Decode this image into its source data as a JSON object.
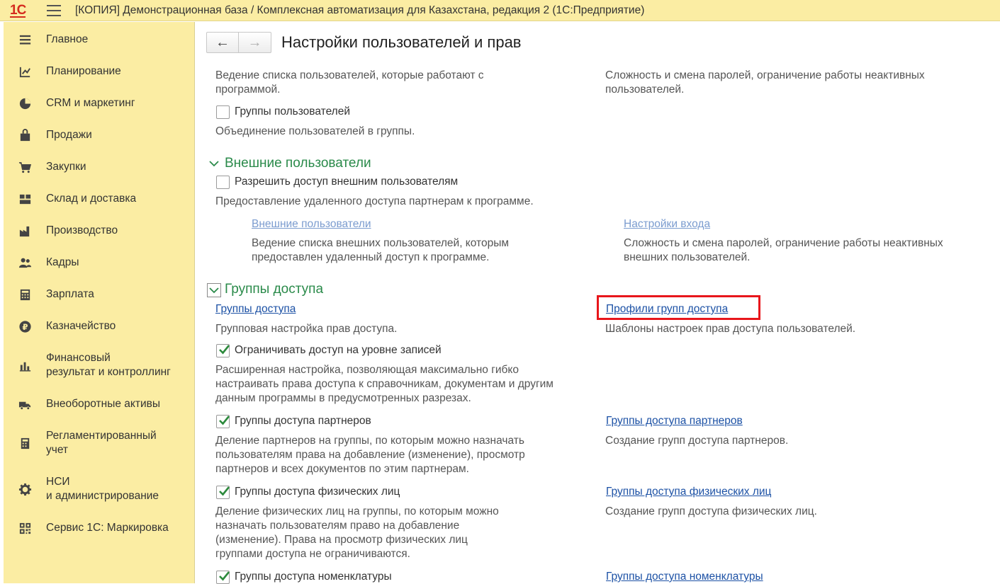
{
  "app": {
    "logo": "1С",
    "title": "[КОПИЯ] Демонстрационная база / Комплексная автоматизация для Казахстана, редакция 2  (1С:Предприятие)"
  },
  "sidebar": {
    "items": [
      {
        "label": "Главное",
        "icon": "list-icon"
      },
      {
        "label": "Планирование",
        "icon": "planning-icon"
      },
      {
        "label": "CRM и маркетинг",
        "icon": "pie-chart-icon"
      },
      {
        "label": "Продажи",
        "icon": "shopping-bag-icon"
      },
      {
        "label": "Закупки",
        "icon": "cart-icon"
      },
      {
        "label": "Склад и доставка",
        "icon": "warehouse-icon"
      },
      {
        "label": "Производство",
        "icon": "factory-icon"
      },
      {
        "label": "Кадры",
        "icon": "people-icon"
      },
      {
        "label": "Зарплата",
        "icon": "calculator-icon"
      },
      {
        "label": "Казначейство",
        "icon": "ruble-coin-icon"
      },
      {
        "label": "Финансовый\nрезультат и контроллинг",
        "icon": "bar-chart-icon"
      },
      {
        "label": "Внеоборотные активы",
        "icon": "truck-icon"
      },
      {
        "label": "Регламентированный\nучет",
        "icon": "document-calc-icon"
      },
      {
        "label": "НСИ\nи администрирование",
        "icon": "gear-icon"
      },
      {
        "label": "Сервис 1С: Маркировка",
        "icon": "qr-code-icon"
      }
    ]
  },
  "header": {
    "back": "←",
    "forward": "→",
    "title": "Настройки пользователей и прав"
  },
  "top_block": {
    "left_desc": "Ведение списка пользователей, которые работают с\nпрограммой.",
    "right_desc": "Сложность и смена паролей, ограничение работы неактивных\nпользователей.",
    "user_groups_label": "Группы пользователей",
    "user_groups_checked": false,
    "user_groups_desc": "Объединение пользователей в группы."
  },
  "external": {
    "title": "Внешние пользователи",
    "allow_label": "Разрешить доступ внешним пользователям",
    "allow_checked": false,
    "allow_desc": "Предоставление удаленного доступа партнерам к программе.",
    "link_users": "Внешние пользователи",
    "link_users_desc": "Ведение списка внешних пользователей, которым\nпредоставлен удаленный доступ к программе.",
    "link_login": "Настройки входа",
    "link_login_desc": "Сложность и смена паролей, ограничение работы неактивных\nвнешних пользователей."
  },
  "access": {
    "title": "Группы доступа",
    "link_groups": "Группы доступа",
    "link_groups_desc": "Групповая настройка прав доступа.",
    "link_profiles": "Профили групп доступа",
    "link_profiles_desc": "Шаблоны настроек прав доступа пользователей.",
    "records_label": "Ограничивать доступ на уровне записей",
    "records_checked": true,
    "records_desc": "Расширенная настройка, позволяющая максимально гибко\nнастраивать права доступа к справочникам, документам и другим\nданным программы в предусмотренных разрезах.",
    "partners_label": "Группы доступа партнеров",
    "partners_checked": true,
    "partners_desc": "Деление партнеров на группы, по которым можно назначать\nпользователям права на добавление (изменение), просмотр\nпартнеров и всех документов по этим партнерам.",
    "partners_link": "Группы доступа партнеров",
    "partners_link_desc": "Создание групп доступа партнеров.",
    "persons_label": "Группы доступа физических лиц",
    "persons_checked": true,
    "persons_desc": "Деление физических лиц на группы, по которым можно\nназначать пользователям право на добавление\n(изменение). Права на просмотр физических лиц\nгруппами доступа не ограничиваются.",
    "persons_link": "Группы доступа физических лиц",
    "persons_link_desc": "Создание групп доступа физических лиц.",
    "items_label": "Группы доступа номенклатуры",
    "items_checked": true,
    "items_link": "Группы доступа номенклатуры"
  },
  "colors": {
    "sidebar_bg": "#fbeda3",
    "section_green": "#2a8a4a",
    "link_blue": "#1c51a5",
    "highlight_red": "#e8161b",
    "check_green": "#2c8a3c"
  }
}
